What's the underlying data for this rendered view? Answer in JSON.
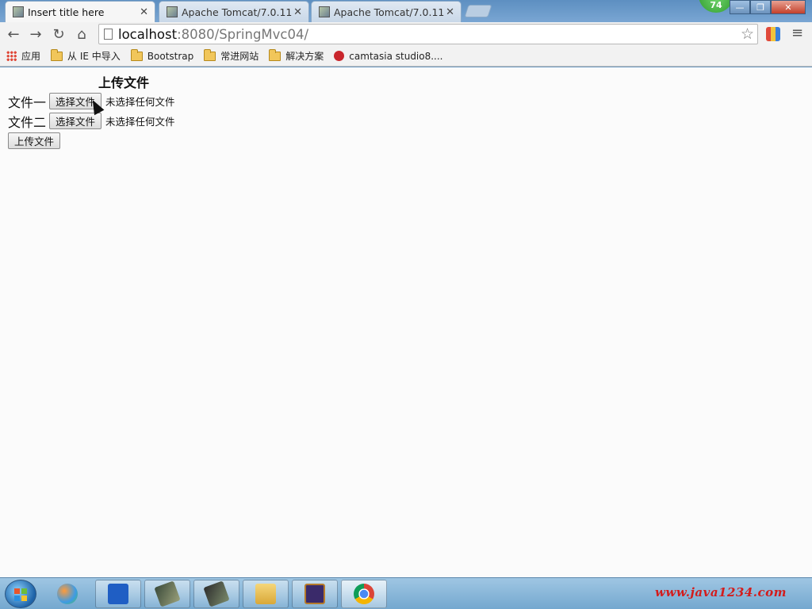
{
  "browser": {
    "tabs": [
      {
        "title": "Insert title here",
        "active": true
      },
      {
        "title": "Apache Tomcat/7.0.11",
        "active": false
      },
      {
        "title": "Apache Tomcat/7.0.11",
        "active": false
      }
    ],
    "notification_count": "74",
    "address": {
      "host": "localhost",
      "path": ":8080/SpringMvc04/"
    },
    "bookmarks": [
      {
        "label": "应用",
        "icon": "apps-grid-icon"
      },
      {
        "label": "从 IE 中导入",
        "icon": "folder-icon"
      },
      {
        "label": "Bootstrap",
        "icon": "folder-icon"
      },
      {
        "label": "常进网站",
        "icon": "folder-icon"
      },
      {
        "label": "解决方案",
        "icon": "folder-icon"
      },
      {
        "label": "camtasia studio8....",
        "icon": "camtasia-icon"
      }
    ]
  },
  "page": {
    "heading": "上传文件",
    "file_rows": [
      {
        "label": "文件一",
        "button": "选择文件",
        "status": "未选择任何文件"
      },
      {
        "label": "文件二",
        "button": "选择文件",
        "status": "未选择任何文件"
      }
    ],
    "submit_label": "上传文件"
  },
  "taskbar": {
    "items": [
      "ball-app-icon",
      "wps-writer-icon",
      "app-icon-3",
      "app-icon-4",
      "file-explorer-icon",
      "java-ee-ide-icon",
      "chrome-icon"
    ],
    "watermark": "www.java1234.com"
  }
}
